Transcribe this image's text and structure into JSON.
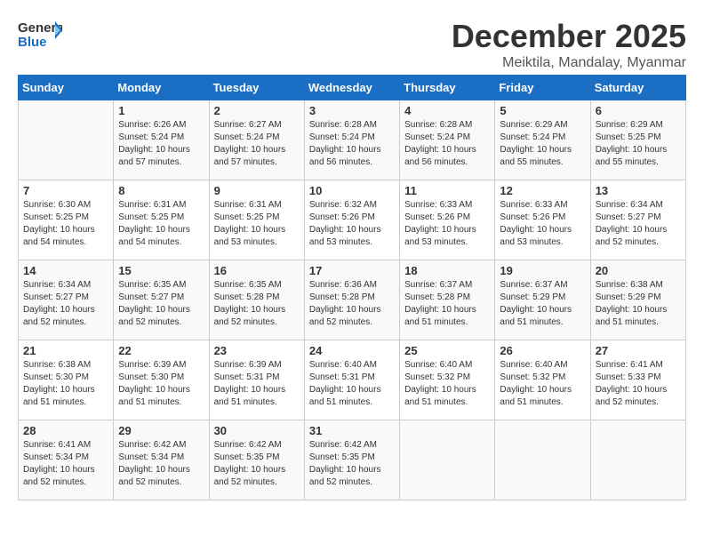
{
  "header": {
    "logo_general": "General",
    "logo_blue": "Blue",
    "month_title": "December 2025",
    "subtitle": "Meiktila, Mandalay, Myanmar"
  },
  "days_of_week": [
    "Sunday",
    "Monday",
    "Tuesday",
    "Wednesday",
    "Thursday",
    "Friday",
    "Saturday"
  ],
  "weeks": [
    [
      {
        "day": "",
        "info": ""
      },
      {
        "day": "1",
        "info": "Sunrise: 6:26 AM\nSunset: 5:24 PM\nDaylight: 10 hours\nand 57 minutes."
      },
      {
        "day": "2",
        "info": "Sunrise: 6:27 AM\nSunset: 5:24 PM\nDaylight: 10 hours\nand 57 minutes."
      },
      {
        "day": "3",
        "info": "Sunrise: 6:28 AM\nSunset: 5:24 PM\nDaylight: 10 hours\nand 56 minutes."
      },
      {
        "day": "4",
        "info": "Sunrise: 6:28 AM\nSunset: 5:24 PM\nDaylight: 10 hours\nand 56 minutes."
      },
      {
        "day": "5",
        "info": "Sunrise: 6:29 AM\nSunset: 5:24 PM\nDaylight: 10 hours\nand 55 minutes."
      },
      {
        "day": "6",
        "info": "Sunrise: 6:29 AM\nSunset: 5:25 PM\nDaylight: 10 hours\nand 55 minutes."
      }
    ],
    [
      {
        "day": "7",
        "info": "Sunrise: 6:30 AM\nSunset: 5:25 PM\nDaylight: 10 hours\nand 54 minutes."
      },
      {
        "day": "8",
        "info": "Sunrise: 6:31 AM\nSunset: 5:25 PM\nDaylight: 10 hours\nand 54 minutes."
      },
      {
        "day": "9",
        "info": "Sunrise: 6:31 AM\nSunset: 5:25 PM\nDaylight: 10 hours\nand 53 minutes."
      },
      {
        "day": "10",
        "info": "Sunrise: 6:32 AM\nSunset: 5:26 PM\nDaylight: 10 hours\nand 53 minutes."
      },
      {
        "day": "11",
        "info": "Sunrise: 6:33 AM\nSunset: 5:26 PM\nDaylight: 10 hours\nand 53 minutes."
      },
      {
        "day": "12",
        "info": "Sunrise: 6:33 AM\nSunset: 5:26 PM\nDaylight: 10 hours\nand 53 minutes."
      },
      {
        "day": "13",
        "info": "Sunrise: 6:34 AM\nSunset: 5:27 PM\nDaylight: 10 hours\nand 52 minutes."
      }
    ],
    [
      {
        "day": "14",
        "info": "Sunrise: 6:34 AM\nSunset: 5:27 PM\nDaylight: 10 hours\nand 52 minutes."
      },
      {
        "day": "15",
        "info": "Sunrise: 6:35 AM\nSunset: 5:27 PM\nDaylight: 10 hours\nand 52 minutes."
      },
      {
        "day": "16",
        "info": "Sunrise: 6:35 AM\nSunset: 5:28 PM\nDaylight: 10 hours\nand 52 minutes."
      },
      {
        "day": "17",
        "info": "Sunrise: 6:36 AM\nSunset: 5:28 PM\nDaylight: 10 hours\nand 52 minutes."
      },
      {
        "day": "18",
        "info": "Sunrise: 6:37 AM\nSunset: 5:28 PM\nDaylight: 10 hours\nand 51 minutes."
      },
      {
        "day": "19",
        "info": "Sunrise: 6:37 AM\nSunset: 5:29 PM\nDaylight: 10 hours\nand 51 minutes."
      },
      {
        "day": "20",
        "info": "Sunrise: 6:38 AM\nSunset: 5:29 PM\nDaylight: 10 hours\nand 51 minutes."
      }
    ],
    [
      {
        "day": "21",
        "info": "Sunrise: 6:38 AM\nSunset: 5:30 PM\nDaylight: 10 hours\nand 51 minutes."
      },
      {
        "day": "22",
        "info": "Sunrise: 6:39 AM\nSunset: 5:30 PM\nDaylight: 10 hours\nand 51 minutes."
      },
      {
        "day": "23",
        "info": "Sunrise: 6:39 AM\nSunset: 5:31 PM\nDaylight: 10 hours\nand 51 minutes."
      },
      {
        "day": "24",
        "info": "Sunrise: 6:40 AM\nSunset: 5:31 PM\nDaylight: 10 hours\nand 51 minutes."
      },
      {
        "day": "25",
        "info": "Sunrise: 6:40 AM\nSunset: 5:32 PM\nDaylight: 10 hours\nand 51 minutes."
      },
      {
        "day": "26",
        "info": "Sunrise: 6:40 AM\nSunset: 5:32 PM\nDaylight: 10 hours\nand 51 minutes."
      },
      {
        "day": "27",
        "info": "Sunrise: 6:41 AM\nSunset: 5:33 PM\nDaylight: 10 hours\nand 52 minutes."
      }
    ],
    [
      {
        "day": "28",
        "info": "Sunrise: 6:41 AM\nSunset: 5:34 PM\nDaylight: 10 hours\nand 52 minutes."
      },
      {
        "day": "29",
        "info": "Sunrise: 6:42 AM\nSunset: 5:34 PM\nDaylight: 10 hours\nand 52 minutes."
      },
      {
        "day": "30",
        "info": "Sunrise: 6:42 AM\nSunset: 5:35 PM\nDaylight: 10 hours\nand 52 minutes."
      },
      {
        "day": "31",
        "info": "Sunrise: 6:42 AM\nSunset: 5:35 PM\nDaylight: 10 hours\nand 52 minutes."
      },
      {
        "day": "",
        "info": ""
      },
      {
        "day": "",
        "info": ""
      },
      {
        "day": "",
        "info": ""
      }
    ]
  ]
}
